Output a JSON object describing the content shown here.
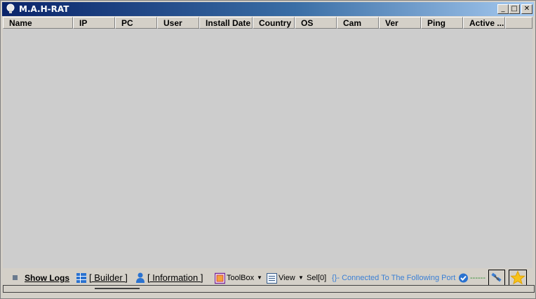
{
  "window": {
    "title": "M.A.H-RAT"
  },
  "title_buttons": {
    "minimize": "_",
    "maximize": "□",
    "close": "✕"
  },
  "columns": [
    "Name",
    "IP",
    "PC",
    "User",
    "Install Date",
    "Country",
    "OS",
    "Cam",
    "Ver",
    "Ping",
    "Active ..."
  ],
  "status": {
    "show_logs": "Show Logs",
    "builder": "[ Builder ]",
    "information": "[ Information ]",
    "toolbox": "ToolBox",
    "view": "View",
    "sel": "Sel[0]",
    "connected": "{}- Connected To The Following Port",
    "port_dashes": "------"
  },
  "colors": {
    "title_start": "#0a246a",
    "title_end": "#a6caf0",
    "connected_text": "#3a7fd5",
    "dash_green": "#2e8b2e"
  },
  "icons": [
    "bulb-icon",
    "grid-icon",
    "user-icon",
    "toolbox-icon",
    "list-view-icon",
    "check-circle-icon",
    "satellite-icon",
    "star-icon"
  ]
}
